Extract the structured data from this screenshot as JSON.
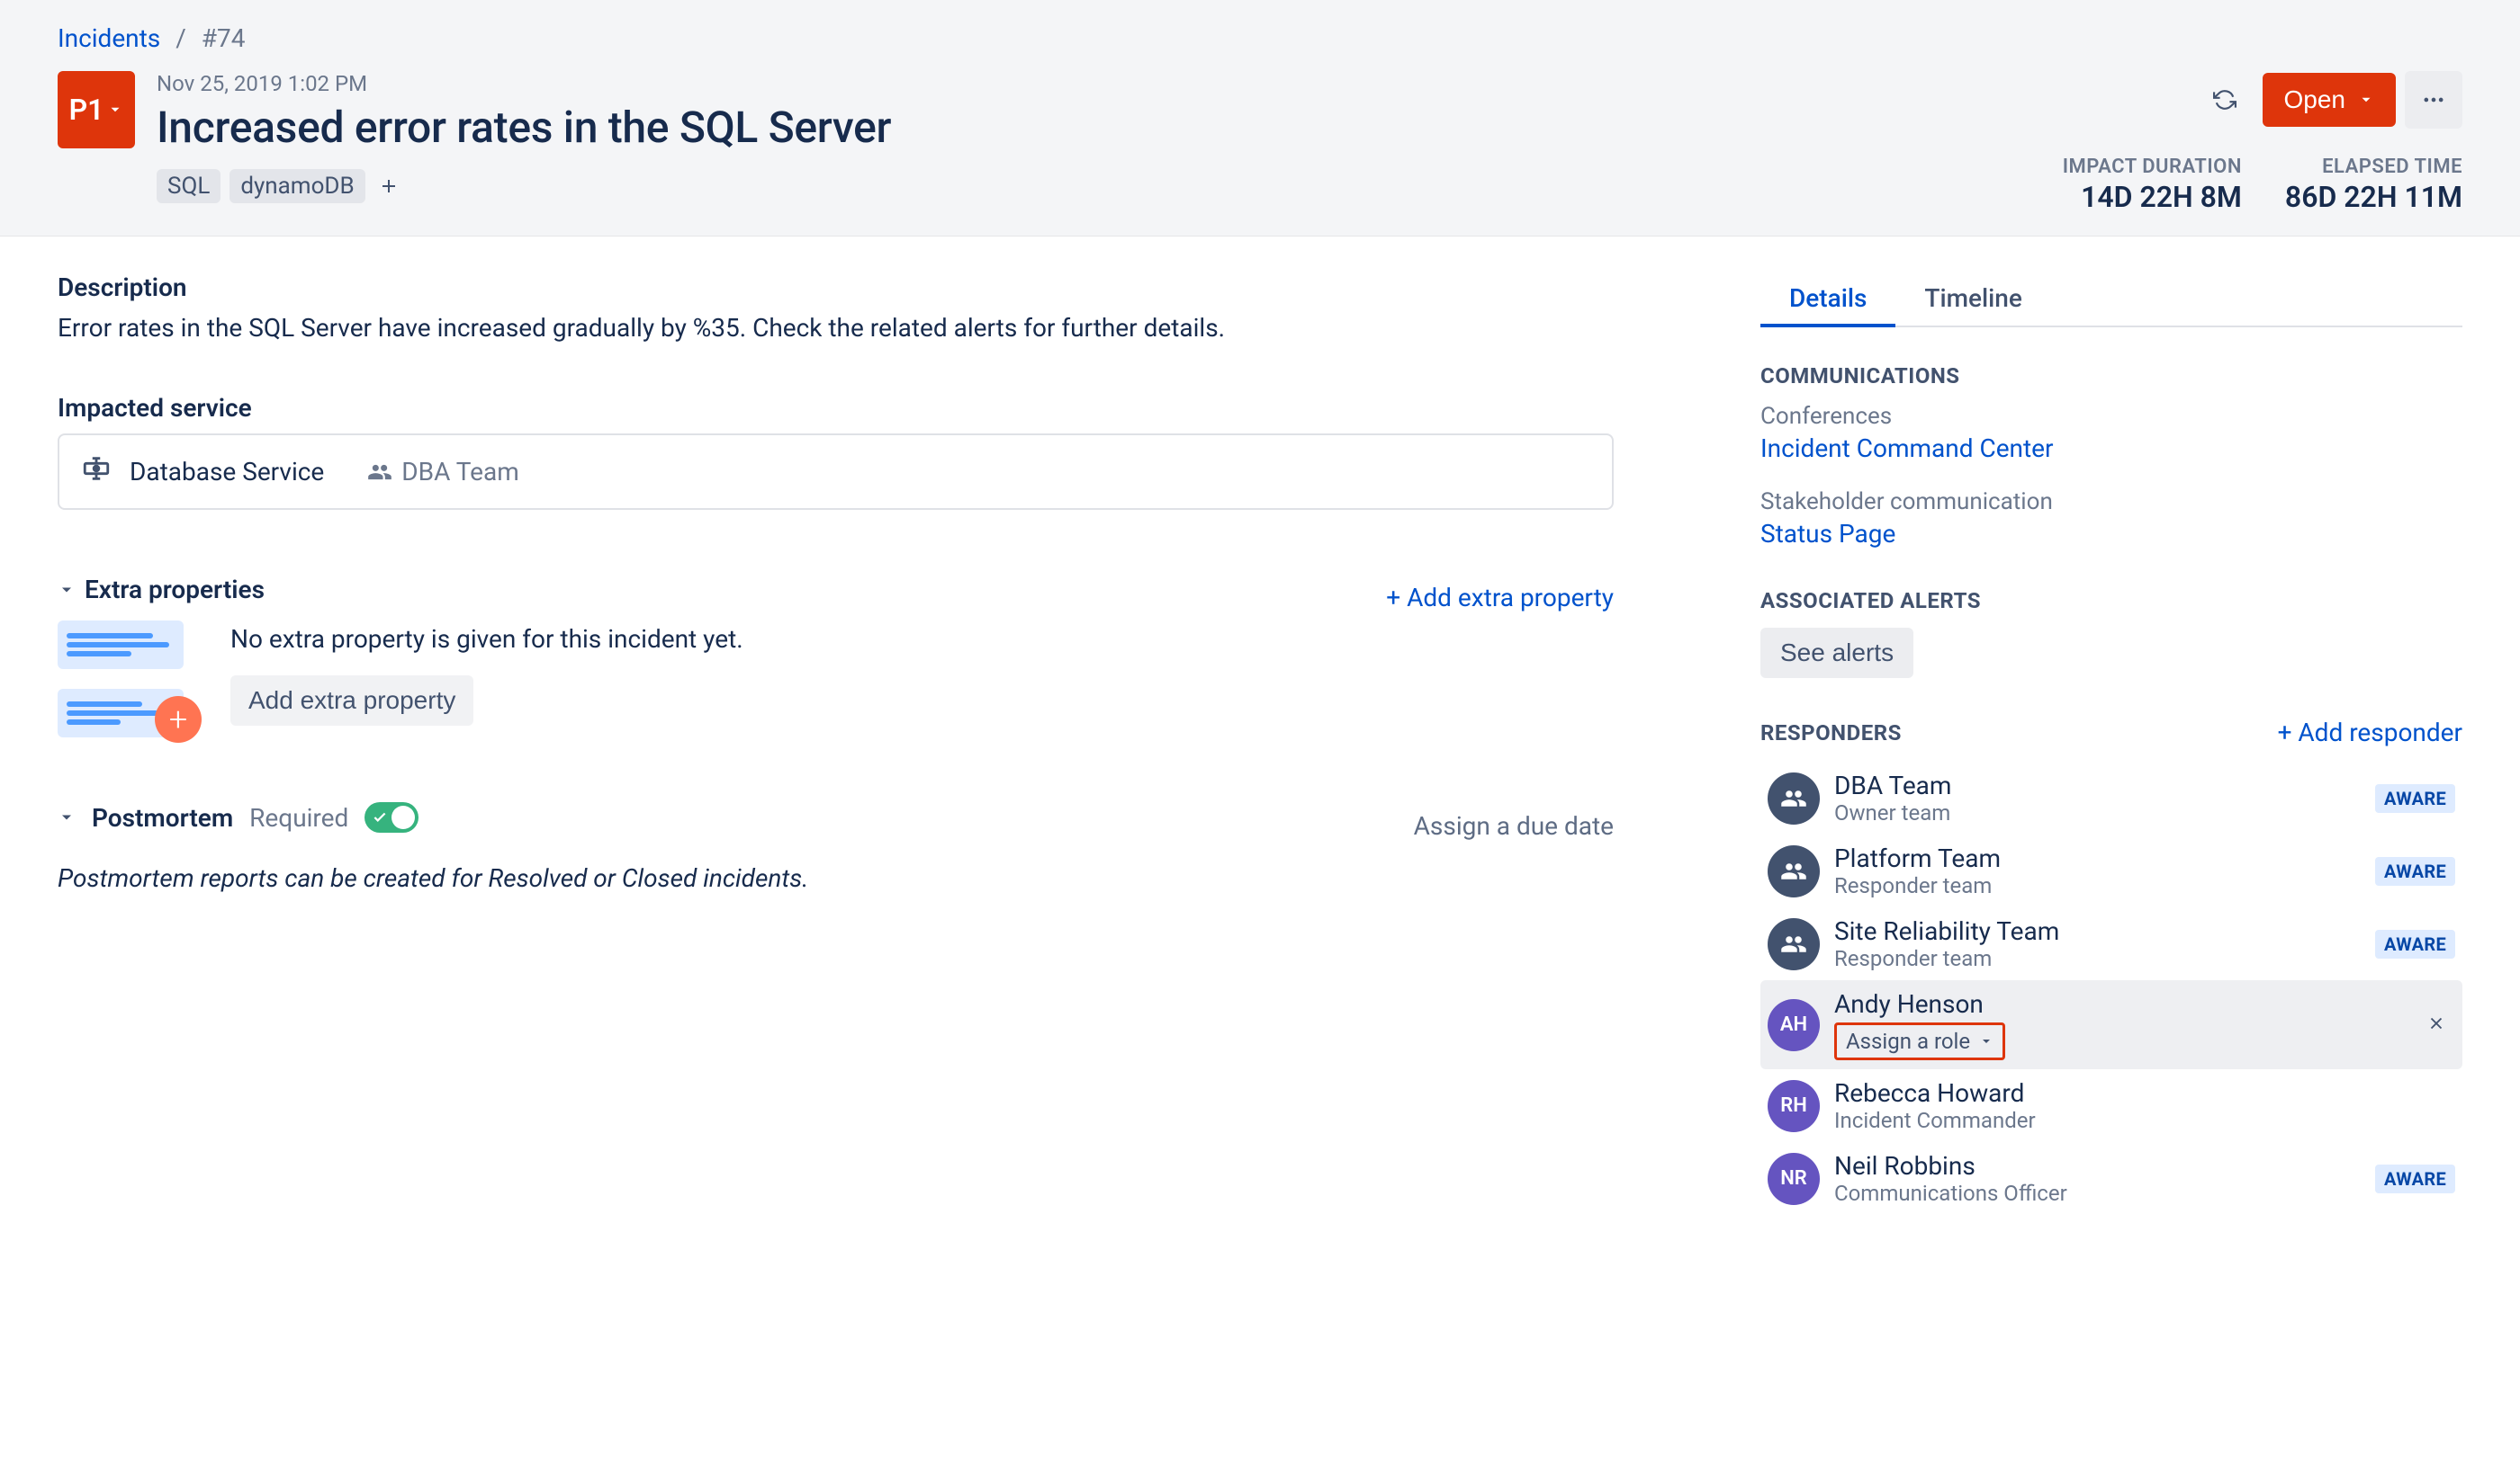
{
  "breadcrumb": {
    "root": "Incidents",
    "id": "#74"
  },
  "priority": "P1",
  "timestamp": "Nov 25, 2019 1:02 PM",
  "title": "Increased error rates in the SQL Server",
  "tags": [
    "SQL",
    "dynamoDB"
  ],
  "status_button": "Open",
  "durations": {
    "impact": {
      "label": "IMPACT DURATION",
      "value": "14D 22H 8M"
    },
    "elapsed": {
      "label": "ELAPSED TIME",
      "value": "86D 22H 11M"
    }
  },
  "description": {
    "heading": "Description",
    "text": "Error rates in the SQL Server have increased gradually by %35. Check the related alerts for further details."
  },
  "impacted": {
    "heading": "Impacted service",
    "service_name": "Database Service",
    "team_name": "DBA Team"
  },
  "extra_props": {
    "heading": "Extra properties",
    "add_link": "+ Add extra property",
    "empty_msg": "No extra property is given for this incident yet.",
    "add_button": "Add extra property"
  },
  "postmortem": {
    "heading": "Postmortem",
    "required_label": "Required",
    "assign_due": "Assign a due date",
    "note": "Postmortem reports can be created for Resolved or Closed incidents."
  },
  "tabs": {
    "details": "Details",
    "timeline": "Timeline"
  },
  "communications": {
    "heading": "COMMUNICATIONS",
    "conferences_label": "Conferences",
    "conference_link": "Incident Command Center",
    "stakeholder_label": "Stakeholder communication",
    "status_page_link": "Status Page"
  },
  "alerts": {
    "heading": "ASSOCIATED ALERTS",
    "see_button": "See alerts"
  },
  "responders": {
    "heading": "RESPONDERS",
    "add_link": "+ Add responder",
    "assign_role_label": "Assign a role",
    "status_aware": "AWARE",
    "items": [
      {
        "name": "DBA Team",
        "role": "Owner team",
        "status": "AWARE",
        "type": "team",
        "initials": ""
      },
      {
        "name": "Platform Team",
        "role": "Responder team",
        "status": "AWARE",
        "type": "team",
        "initials": ""
      },
      {
        "name": "Site Reliability Team",
        "role": "Responder team",
        "status": "AWARE",
        "type": "team",
        "initials": ""
      },
      {
        "name": "Andy Henson",
        "role": "",
        "status": "",
        "type": "user",
        "initials": "AH",
        "highlighted": true,
        "assign_role": true
      },
      {
        "name": "Rebecca Howard",
        "role": "Incident Commander",
        "status": "",
        "type": "user",
        "initials": "RH"
      },
      {
        "name": "Neil Robbins",
        "role": "Communications Officer",
        "status": "AWARE",
        "type": "user",
        "initials": "NR"
      }
    ]
  }
}
